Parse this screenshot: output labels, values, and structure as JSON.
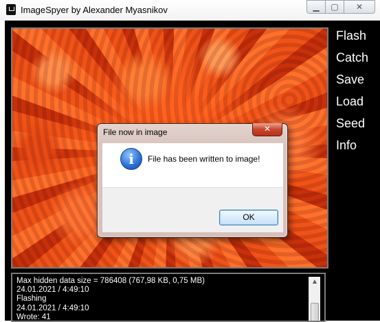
{
  "window": {
    "title": "ImageSpyer by Alexander Myasnikov",
    "minimize_glyph": "▁",
    "maximize_glyph": "▢",
    "close_glyph": "✕"
  },
  "side_menu": {
    "items": [
      {
        "label": "Flash"
      },
      {
        "label": "Catch"
      },
      {
        "label": "Save"
      },
      {
        "label": "Load"
      },
      {
        "label": "Seed"
      },
      {
        "label": "Info"
      }
    ]
  },
  "image": {
    "subject": "orange chrysanthemum petals close-up"
  },
  "log": {
    "lines": [
      "Max hidden data size = 786408 (767,98 KB, 0,75 MB)",
      "24.01.2021 / 4:49:10",
      "Flashing",
      "24.01.2021 / 4:49:10",
      "Wrote: 41"
    ]
  },
  "dialog": {
    "title": "File now in image",
    "close_glyph": "✕",
    "icon": "info-icon",
    "icon_glyph": "i",
    "message": "File has been written to image!",
    "ok_label": "OK"
  },
  "colors": {
    "client_background": "#000000",
    "menu_text": "#ffffff",
    "dialog_close": "#c8452c",
    "info_blue": "#2a6fd4"
  }
}
